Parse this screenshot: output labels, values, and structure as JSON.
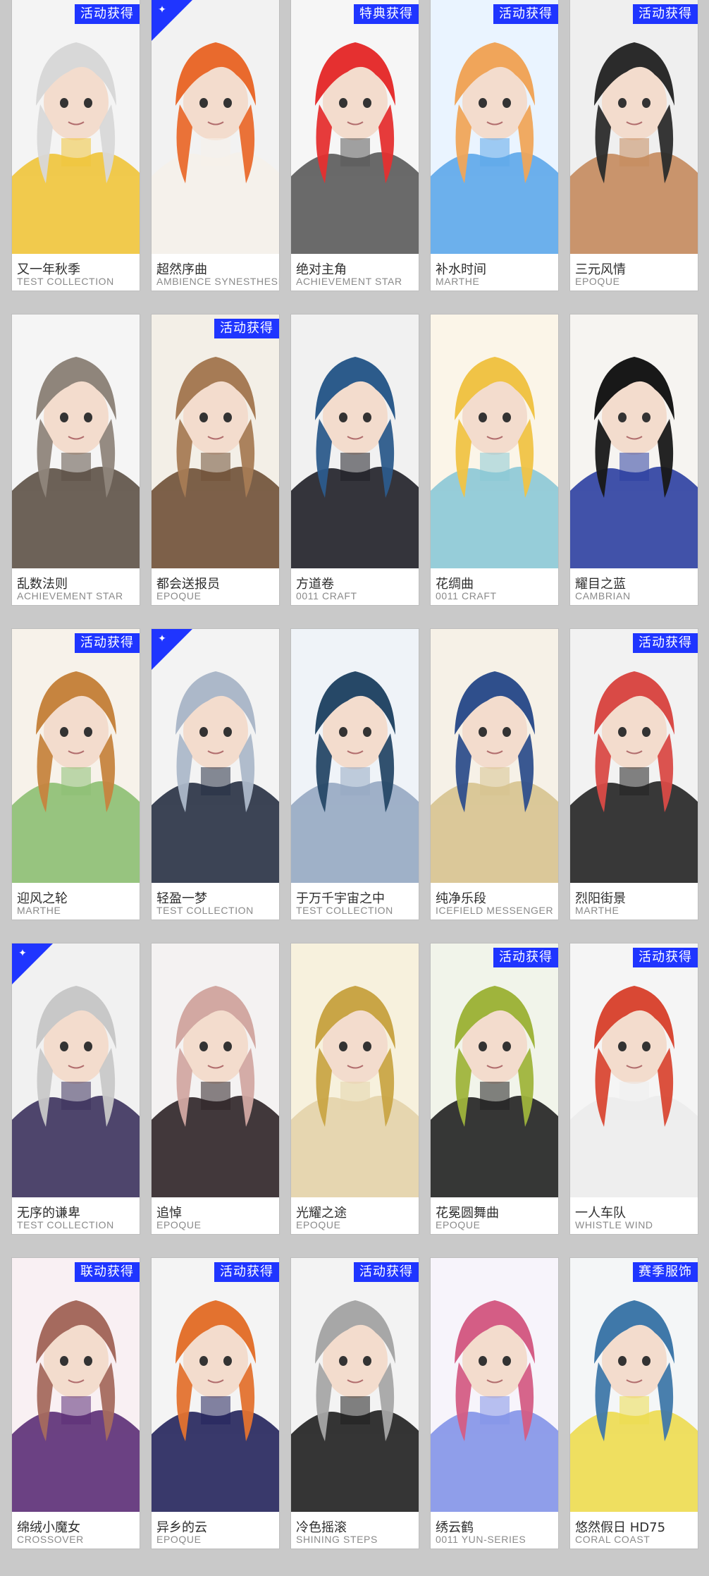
{
  "badges": {
    "activity": "活动获得",
    "special": "特典获得",
    "collab": "联动获得",
    "season": "赛季服饰"
  },
  "colors": {
    "background": "#c9c9c9",
    "badge": "#1f35ff",
    "card": "#ffffff",
    "name_text": "#2d2d2d",
    "brand_text": "#8a8a8a"
  },
  "cards": [
    {
      "name": "又一年秋季",
      "brand": "TEST COLLECTION",
      "badge": "活动获得",
      "corner_icon": false,
      "palette": [
        "#f4f4f4",
        "#d8d8d8",
        "#f0c43a"
      ]
    },
    {
      "name": "超然序曲",
      "brand": "AMBIENCE SYNESTHESIA",
      "badge": "",
      "corner_icon": true,
      "palette": [
        "#f2f2f2",
        "#e96a2d",
        "#f5f1ea"
      ]
    },
    {
      "name": "绝对主角",
      "brand": "ACHIEVEMENT STAR",
      "badge": "特典获得",
      "corner_icon": false,
      "palette": [
        "#f6f6f6",
        "#e53030",
        "#5a5a5a"
      ]
    },
    {
      "name": "补水时间",
      "brand": "MARTHE",
      "badge": "活动获得",
      "corner_icon": false,
      "palette": [
        "#eaf4ff",
        "#f0a55a",
        "#5da7ea"
      ]
    },
    {
      "name": "三元风情",
      "brand": "EPOQUE",
      "badge": "活动获得",
      "corner_icon": false,
      "palette": [
        "#efefef",
        "#2b2b2b",
        "#c48a5d"
      ]
    },
    {
      "name": "乱数法则",
      "brand": "ACHIEVEMENT STAR",
      "badge": "",
      "corner_icon": false,
      "palette": [
        "#f5f5f5",
        "#8f857b",
        "#5d5146"
      ]
    },
    {
      "name": "都会送报员",
      "brand": "EPOQUE",
      "badge": "活动获得",
      "corner_icon": false,
      "palette": [
        "#f3efe7",
        "#a67b55",
        "#6f5036"
      ]
    },
    {
      "name": "方道卷",
      "brand": "0011 CRAFT",
      "badge": "",
      "corner_icon": false,
      "palette": [
        "#f1f1f1",
        "#2c5b8b",
        "#1f1f27"
      ]
    },
    {
      "name": "花绸曲",
      "brand": "0011 CRAFT",
      "badge": "",
      "corner_icon": false,
      "palette": [
        "#fbf5e8",
        "#f0c346",
        "#8bc8d6"
      ]
    },
    {
      "name": "耀目之蓝",
      "brand": "CAMBRIAN",
      "badge": "",
      "corner_icon": false,
      "palette": [
        "#f6f4f1",
        "#181818",
        "#2c3fa1"
      ]
    },
    {
      "name": "迎风之轮",
      "brand": "MARTHE",
      "badge": "活动获得",
      "corner_icon": false,
      "palette": [
        "#f7f2ea",
        "#c6843f",
        "#8cbf72"
      ]
    },
    {
      "name": "轻盈一梦",
      "brand": "TEST COLLECTION",
      "badge": "",
      "corner_icon": true,
      "palette": [
        "#f3f3f3",
        "#acb8c9",
        "#273043"
      ]
    },
    {
      "name": "于万千宇宙之中",
      "brand": "TEST COLLECTION",
      "badge": "",
      "corner_icon": false,
      "palette": [
        "#eff3f8",
        "#264867",
        "#96a9c2"
      ]
    },
    {
      "name": "纯净乐段",
      "brand": "ICEFIELD MESSENGER",
      "badge": "",
      "corner_icon": false,
      "palette": [
        "#f6f1e7",
        "#2f4f8c",
        "#d7c38f"
      ]
    },
    {
      "name": "烈阳街景",
      "brand": "MARTHE",
      "badge": "活动获得",
      "corner_icon": false,
      "palette": [
        "#f2f2f2",
        "#d94a46",
        "#232323"
      ]
    },
    {
      "name": "无序的谦卑",
      "brand": "TEST COLLECTION",
      "badge": "",
      "corner_icon": true,
      "palette": [
        "#f1f1f1",
        "#c8c8c8",
        "#3c325d"
      ]
    },
    {
      "name": "追悼",
      "brand": "EPOQUE",
      "badge": "",
      "corner_icon": false,
      "palette": [
        "#f4f2f2",
        "#d2a8a2",
        "#2d2327"
      ]
    },
    {
      "name": "光耀之途",
      "brand": "EPOQUE",
      "badge": "",
      "corner_icon": false,
      "palette": [
        "#f7f1dd",
        "#c9a546",
        "#e3d3aa"
      ]
    },
    {
      "name": "花冕圆舞曲",
      "brand": "EPOQUE",
      "badge": "活动获得",
      "corner_icon": false,
      "palette": [
        "#f1f4ea",
        "#9fb43c",
        "#212121"
      ]
    },
    {
      "name": "一人车队",
      "brand": "WHISTLE WIND",
      "badge": "活动获得",
      "corner_icon": false,
      "palette": [
        "#f5f5f5",
        "#d94834",
        "#ececec"
      ]
    },
    {
      "name": "绵绒小魔女",
      "brand": "CROSSOVER",
      "badge": "联动获得",
      "corner_icon": false,
      "palette": [
        "#f9f0f3",
        "#a56a5e",
        "#5b2d76"
      ]
    },
    {
      "name": "异乡的云",
      "brand": "EPOQUE",
      "badge": "活动获得",
      "corner_icon": false,
      "palette": [
        "#f4f4f4",
        "#e3722f",
        "#23235b"
      ]
    },
    {
      "name": "冷色摇滚",
      "brand": "SHINING STEPS",
      "badge": "活动获得",
      "corner_icon": false,
      "palette": [
        "#f3f3f3",
        "#a7a7a7",
        "#1f1f1f"
      ]
    },
    {
      "name": "绣云鹤",
      "brand": "0011 YUN-SERIES",
      "badge": "",
      "corner_icon": false,
      "palette": [
        "#f7f4fb",
        "#d45d85",
        "#8393e8"
      ]
    },
    {
      "name": "悠然假日 HD75",
      "brand": "CORAL COAST",
      "badge": "赛季服饰",
      "corner_icon": false,
      "palette": [
        "#f4f6f7",
        "#3f78a9",
        "#eddc4f"
      ]
    }
  ]
}
